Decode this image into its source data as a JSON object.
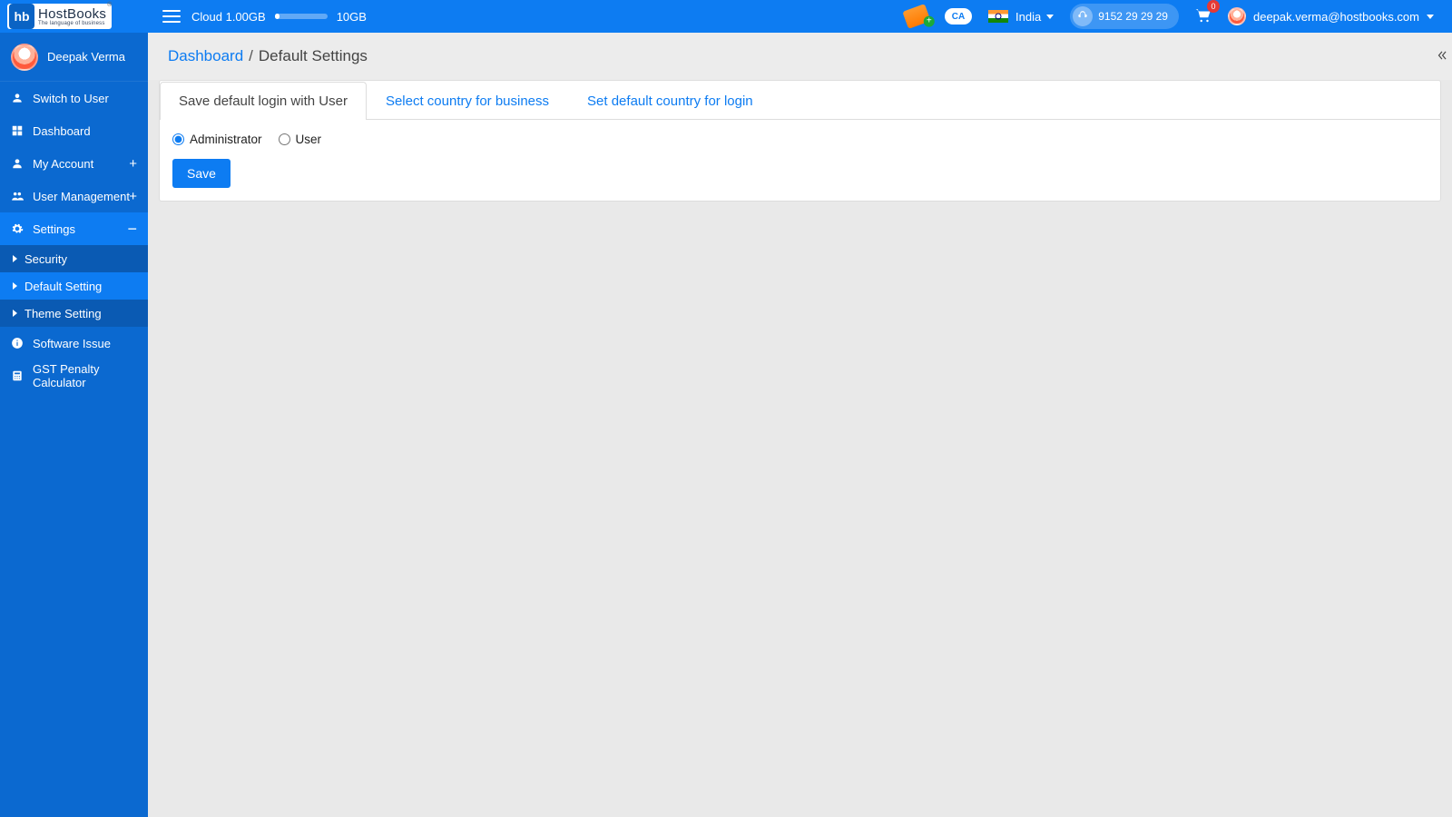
{
  "brand": {
    "logo_short": "hb",
    "logo_main": "HostBooks",
    "logo_tag": "The language of business"
  },
  "topbar": {
    "cloud_label": "Cloud",
    "cloud_used": "1.00GB",
    "cloud_total": "10GB",
    "ca_badge": "CA",
    "country": "India",
    "support_number": "9152 29 29 29",
    "cart_count": "0",
    "user_email": "deepak.verma@hostbooks.com"
  },
  "sidebar": {
    "user_name": "Deepak Verma",
    "items": {
      "switch_user": "Switch to User",
      "dashboard": "Dashboard",
      "my_account": "My Account",
      "user_management": "User Management",
      "settings": "Settings",
      "software_issue": "Software Issue",
      "gst_calc": "GST Penalty Calculator"
    },
    "settings_sub": {
      "security": "Security",
      "default_setting": "Default Setting",
      "theme_setting": "Theme Setting"
    }
  },
  "breadcrumb": {
    "root": "Dashboard",
    "current": "Default Settings"
  },
  "tabs": {
    "t1": "Save default login with User",
    "t2": "Select country for business",
    "t3": "Set default country for login"
  },
  "form": {
    "opt_admin": "Administrator",
    "opt_user": "User",
    "save_btn": "Save"
  }
}
